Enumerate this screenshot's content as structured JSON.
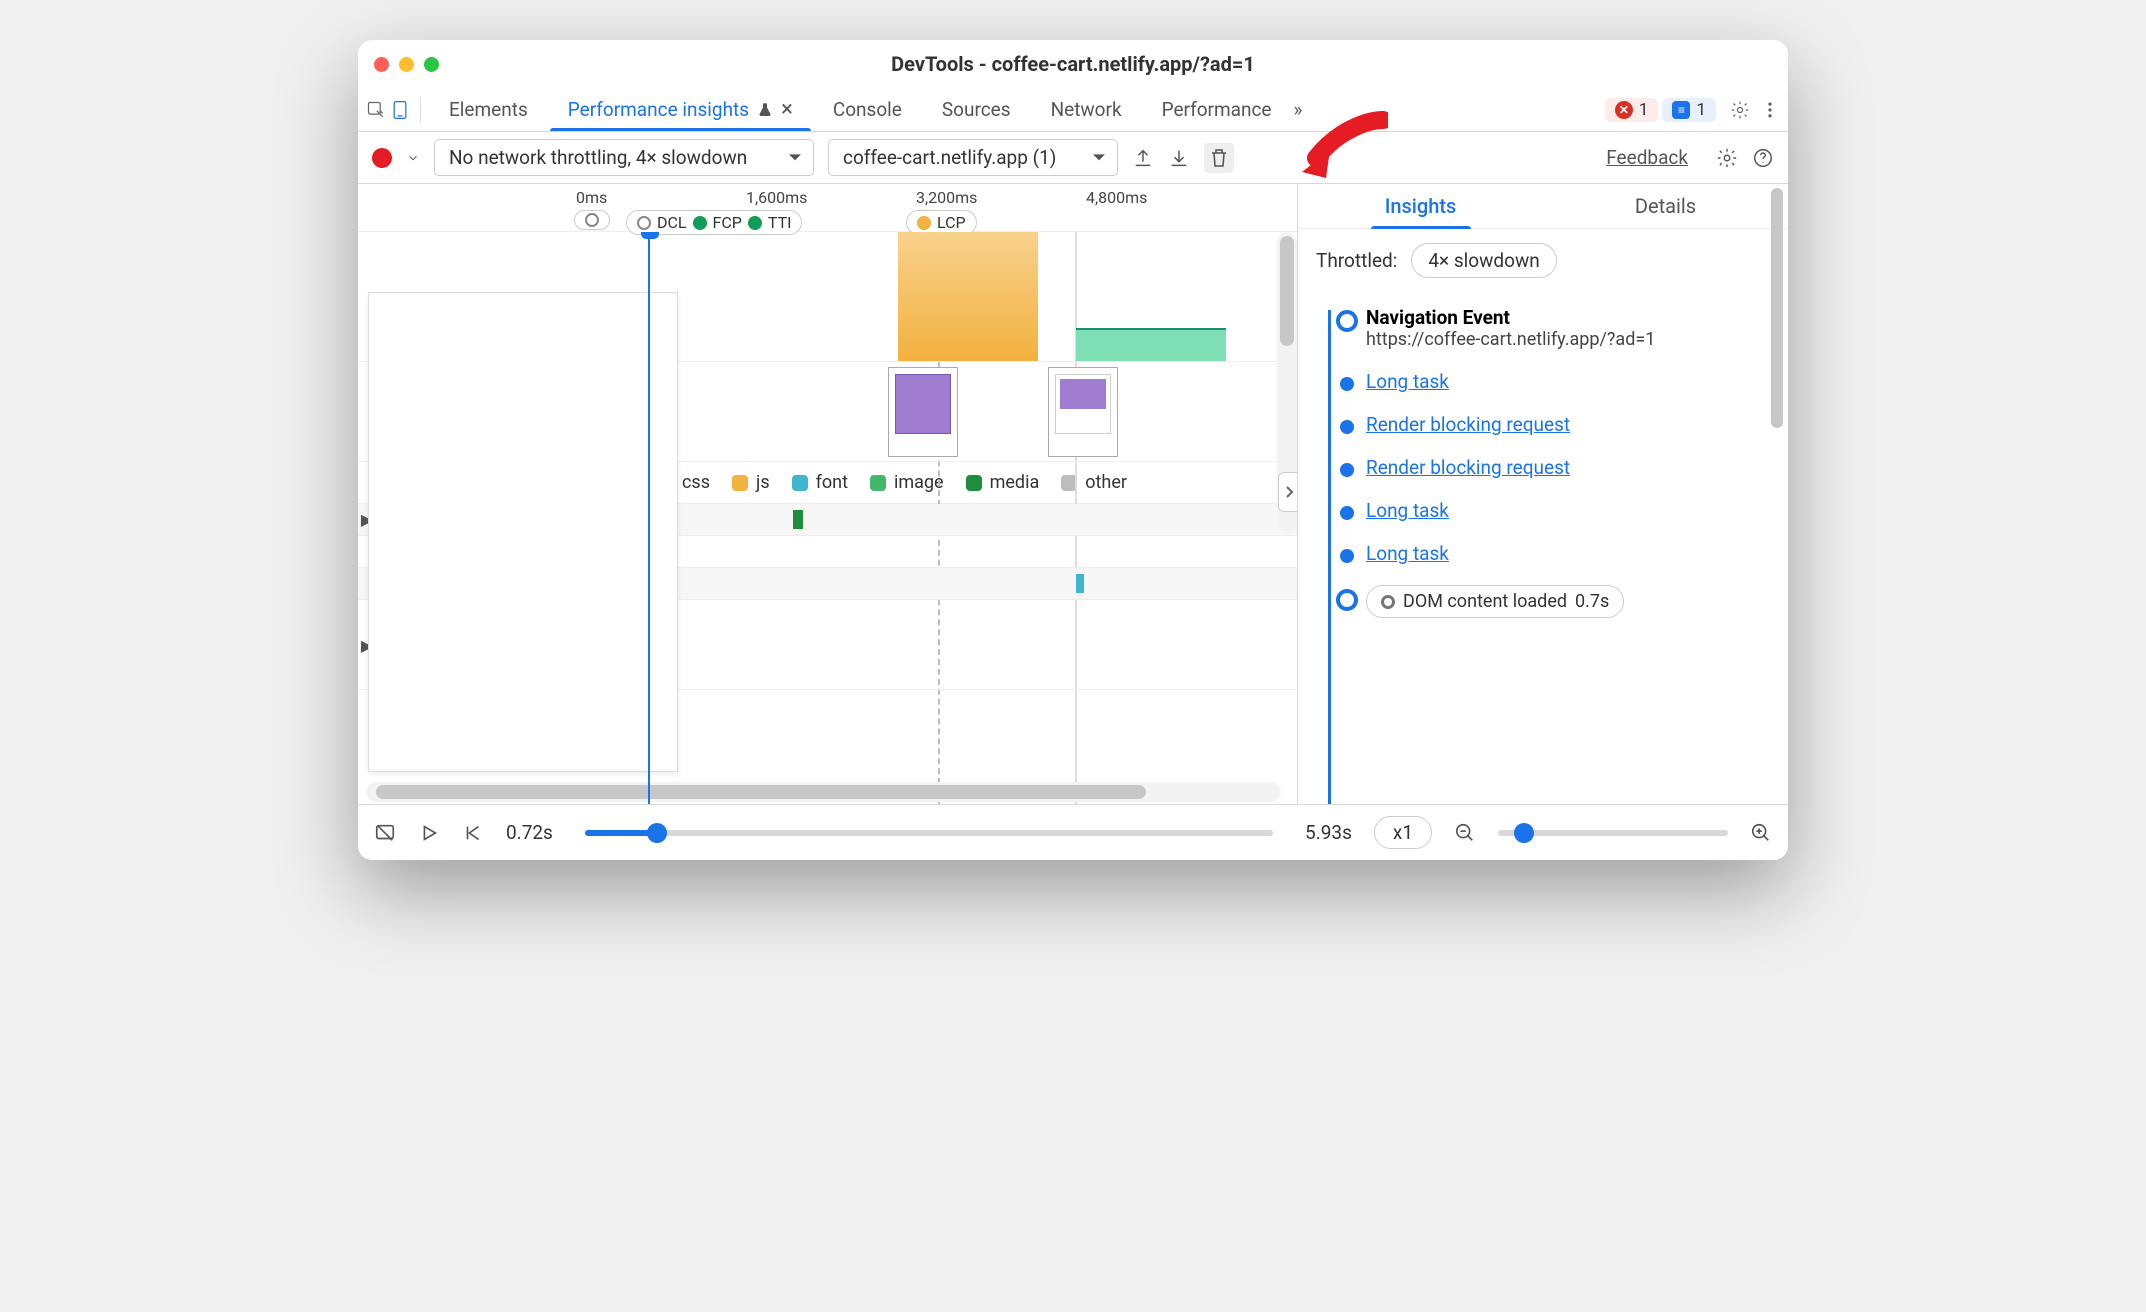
{
  "window": {
    "title": "DevTools - coffee-cart.netlify.app/?ad=1"
  },
  "tabs": {
    "elements": "Elements",
    "perf_insights": "Performance insights",
    "console": "Console",
    "sources": "Sources",
    "network": "Network",
    "performance": "Performance"
  },
  "tabbar": {
    "error_count": "1",
    "feedback_count": "1"
  },
  "toolbar": {
    "throttling_select": "No network throttling, 4× slowdown",
    "recording_select": "coffee-cart.netlify.app (1)",
    "feedback_link": "Feedback"
  },
  "ruler": {
    "t0": "0ms",
    "t1": "1,600ms",
    "t2": "3,200ms",
    "t3": "4,800ms"
  },
  "markers": {
    "dcl": "DCL",
    "fcp": "FCP",
    "tti": "TTI",
    "lcp": "LCP"
  },
  "legend": {
    "css": "css",
    "js": "js",
    "font": "font",
    "image": "image",
    "media": "media",
    "other": "other"
  },
  "right": {
    "tab_insights": "Insights",
    "tab_details": "Details",
    "throttled_label": "Throttled:",
    "throttled_value": "4× slowdown",
    "nav_title": "Navigation Event",
    "nav_url": "https://coffee-cart.netlify.app/?ad=1",
    "items": {
      "i1": "Long task",
      "i2": "Render blocking request",
      "i3": "Render blocking request",
      "i4": "Long task",
      "i5": "Long task"
    },
    "dcl_chip": "DOM content loaded",
    "dcl_time": "0.7s"
  },
  "player": {
    "time": "0.72s",
    "duration": "5.93s",
    "speed": "x1"
  },
  "colors": {
    "css": "#b49bdc",
    "js": "#f3b13f",
    "font": "#3fb5d0",
    "image": "#43b86b",
    "media": "#1e8e3e",
    "other": "#bdbdbd",
    "dcl": "#0f9d58",
    "lcp": "#f3b13f",
    "orange_block": "#f4b14e",
    "green_block": "#7ddfb3"
  }
}
